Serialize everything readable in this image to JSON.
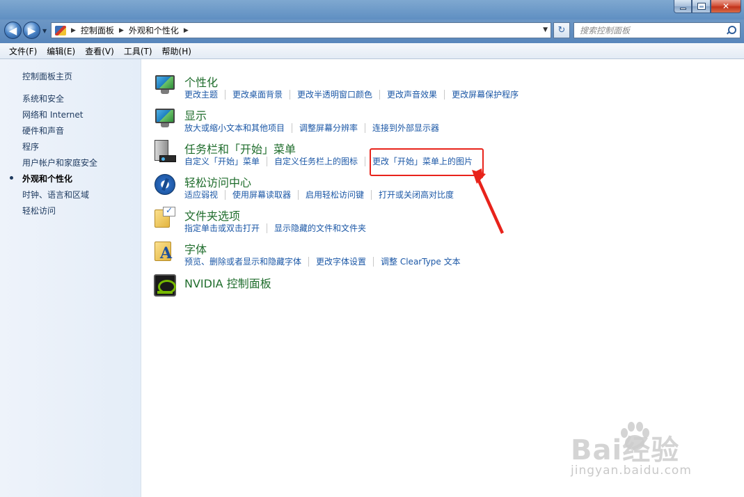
{
  "window": {
    "minimize_icon": "minimize-icon",
    "maximize_icon": "maximize-icon",
    "close_icon": "close-icon",
    "close_glyph": "✕"
  },
  "address_bar": {
    "crumbs": [
      "控制面板",
      "外观和个性化"
    ],
    "search_placeholder": "搜索控制面板"
  },
  "menu": {
    "items": [
      "文件(F)",
      "编辑(E)",
      "查看(V)",
      "工具(T)",
      "帮助(H)"
    ]
  },
  "sidebar": {
    "home": "控制面板主页",
    "items": [
      "系统和安全",
      "网络和 Internet",
      "硬件和声音",
      "程序",
      "用户帐户和家庭安全",
      "外观和个性化",
      "时钟、语言和区域",
      "轻松访问"
    ],
    "active_index": 5
  },
  "categories": [
    {
      "title": "个性化",
      "icon": "personalization-icon",
      "links": [
        "更改主题",
        "更改桌面背景",
        "更改半透明窗口颜色",
        "更改声音效果",
        "更改屏幕保护程序"
      ]
    },
    {
      "title": "显示",
      "icon": "display-icon",
      "links": [
        "放大或缩小文本和其他项目",
        "调整屏幕分辨率",
        "连接到外部显示器"
      ]
    },
    {
      "title": "任务栏和「开始」菜单",
      "icon": "taskbar-icon",
      "links": [
        "自定义「开始」菜单",
        "自定义任务栏上的图标",
        "更改「开始」菜单上的图片"
      ]
    },
    {
      "title": "轻松访问中心",
      "icon": "ease-of-access-icon",
      "links": [
        "适应弱视",
        "使用屏幕读取器",
        "启用轻松访问键",
        "打开或关闭高对比度"
      ]
    },
    {
      "title": "文件夹选项",
      "icon": "folder-options-icon",
      "links": [
        "指定单击或双击打开",
        "显示隐藏的文件和文件夹"
      ]
    },
    {
      "title": "字体",
      "icon": "fonts-icon",
      "links": [
        "预览、删除或者显示和隐藏字体",
        "更改字体设置",
        "调整 ClearType 文本"
      ]
    },
    {
      "title": "NVIDIA 控制面板",
      "icon": "nvidia-icon",
      "links": []
    }
  ],
  "annotation": {
    "color": "#e8231b"
  },
  "watermark": {
    "text": "Bai经验",
    "sub": "jingyan.baidu.com"
  },
  "colors": {
    "link": "#1b57a6",
    "category_title": "#1f6d2c",
    "sidebar_link": "#1e3a5f"
  }
}
